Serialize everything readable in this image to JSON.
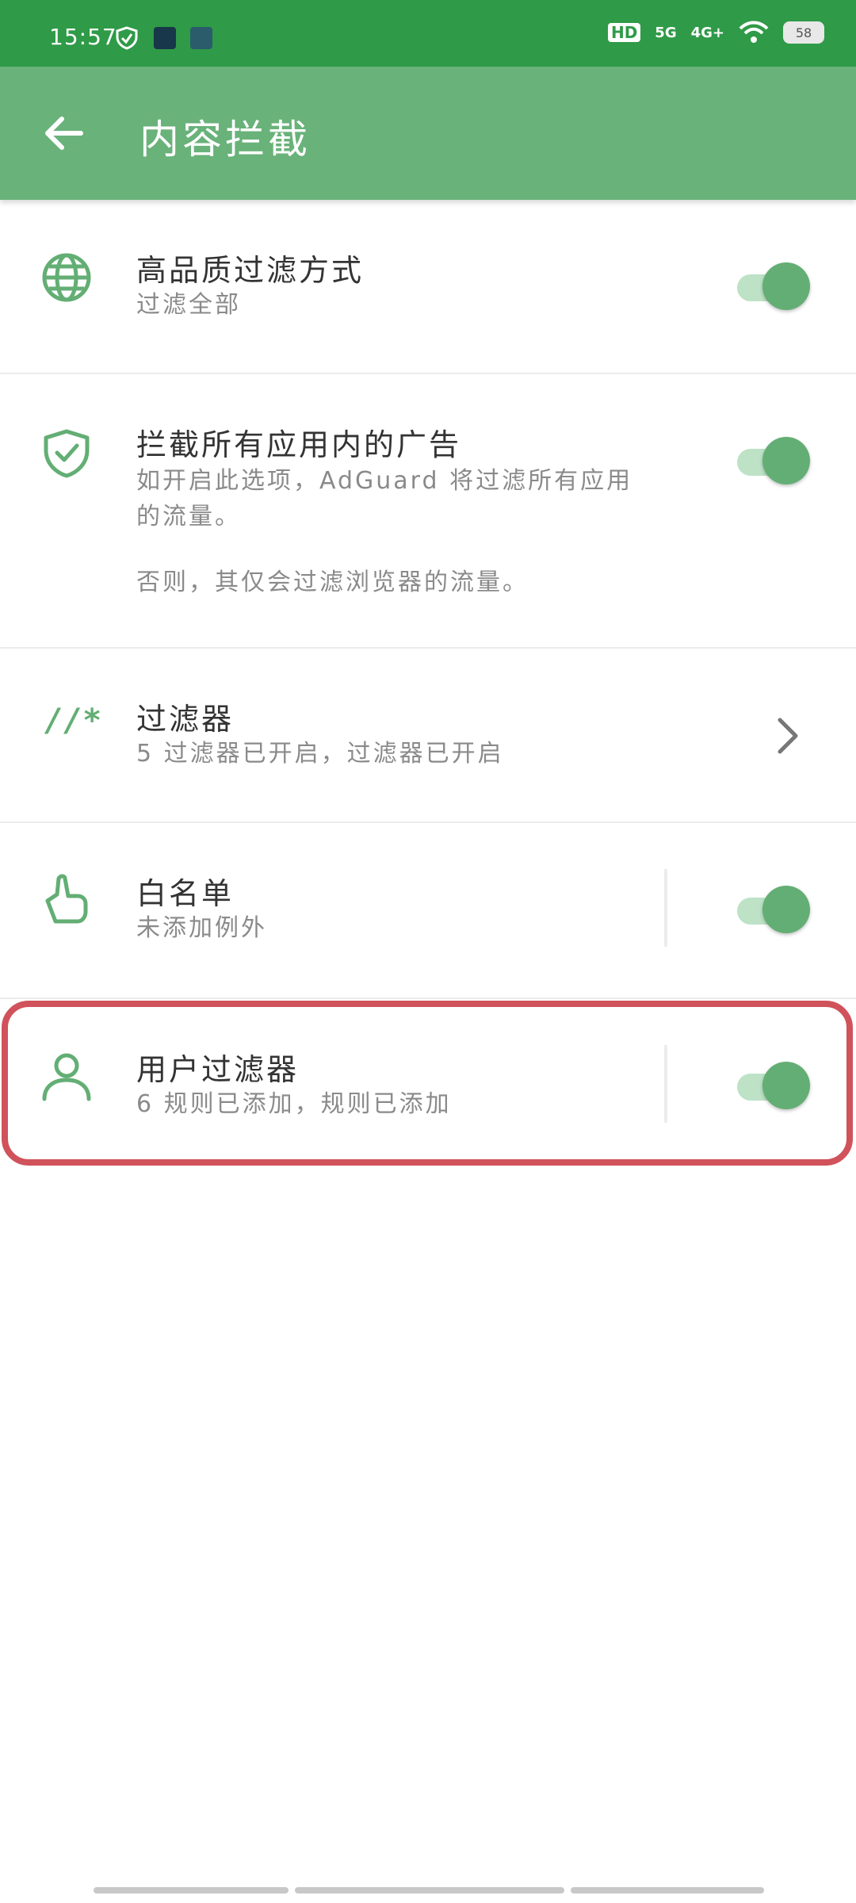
{
  "status_bar": {
    "time": "15:57",
    "network_5g": "5G",
    "network_4g": "4G+",
    "hd_label": "HD",
    "battery": "58"
  },
  "app_bar": {
    "title": "内容拦截",
    "back_icon": "arrow-left-icon"
  },
  "items": [
    {
      "icon": "globe-icon",
      "title": "高品质过滤方式",
      "subtitle": "过滤全部",
      "control": "toggle",
      "enabled": true
    },
    {
      "icon": "shield-check-icon",
      "title": "拦截所有应用内的广告",
      "subtitle": "如开启此选项，AdGuard 将过滤所有应用的流量。",
      "subtitle2": "否则，其仅会过滤浏览器的流量。",
      "control": "toggle",
      "enabled": true
    },
    {
      "icon": "filter-rule-icon",
      "icon_text": "//*",
      "title": "过滤器",
      "subtitle": "5 过滤器已开启，过滤器已开启",
      "control": "chevron"
    },
    {
      "icon": "thumbs-up-icon",
      "title": "白名单",
      "subtitle": "未添加例外",
      "control": "toggle",
      "enabled": true
    },
    {
      "icon": "user-icon",
      "title": "用户过滤器",
      "subtitle": "6 规则已添加，规则已添加",
      "control": "toggle",
      "enabled": true,
      "highlighted": true
    }
  ],
  "colors": {
    "status_bar": "#2f9a47",
    "app_bar": "#69b27a",
    "accent": "#63ae74",
    "highlight_border": "#d0525b"
  }
}
